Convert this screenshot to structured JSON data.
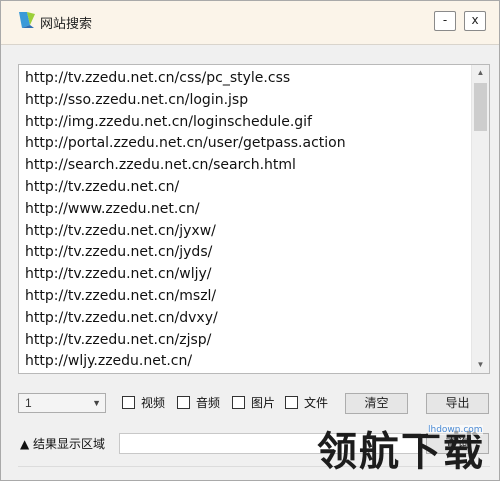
{
  "window": {
    "title": "网站搜索",
    "minimize_label": "-",
    "close_label": "x"
  },
  "url_list": {
    "items": [
      "http://tv.zzedu.net.cn/css/pc_style.css",
      "http://sso.zzedu.net.cn/login.jsp",
      "http://img.zzedu.net.cn/loginschedule.gif",
      "http://portal.zzedu.net.cn/user/getpass.action",
      "http://search.zzedu.net.cn/search.html",
      "http://tv.zzedu.net.cn/",
      "http://www.zzedu.net.cn/",
      "http://tv.zzedu.net.cn/jyxw/",
      "http://tv.zzedu.net.cn/jyds/",
      "http://tv.zzedu.net.cn/wljy/",
      "http://tv.zzedu.net.cn/mszl/",
      "http://tv.zzedu.net.cn/dvxy/",
      "http://tv.zzedu.net.cn/zjsp/",
      "http://wljy.zzedu.net.cn/"
    ]
  },
  "controls": {
    "depth_select_value": "1",
    "checkboxes": [
      {
        "label": "视频",
        "checked": false
      },
      {
        "label": "音频",
        "checked": false
      },
      {
        "label": "图片",
        "checked": false
      },
      {
        "label": "文件",
        "checked": false
      }
    ],
    "clear_label": "清空",
    "export_label": "导出",
    "query_label": "查询"
  },
  "result": {
    "label": "▲ 结果显示区域",
    "value": ""
  },
  "watermark": {
    "url": "lhdown.com",
    "text": "领航下载"
  },
  "colors": {
    "titlebar_bg": "#fbf4e9",
    "watermark_url": "#4a8ad4"
  }
}
